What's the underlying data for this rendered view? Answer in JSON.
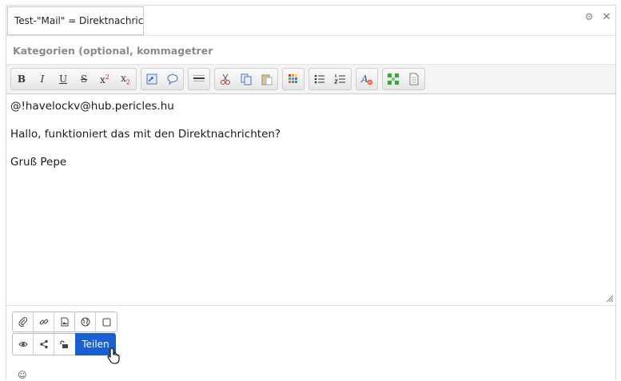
{
  "post": {
    "title_value": "Test-\"Mail\" = Direktnachric",
    "categories_placeholder": "Kategorien (optional, kommagetrer",
    "body": [
      "@!havelockv@hub.pericles.hu",
      "Hallo, funktioniert das mit den Direktnachrichten?",
      "Gruß Pepe"
    ]
  },
  "toolbar": {
    "groups": [
      [
        "bold-icon",
        "italic-icon",
        "underline-icon",
        "strikethrough-icon",
        "superscript-icon",
        "subscript-icon"
      ],
      [
        "insert-link-icon",
        "speech-bubble-icon"
      ],
      [
        "horizontal-rule-icon"
      ],
      [
        "cut-icon",
        "copy-icon",
        "paste-icon"
      ],
      [
        "color-palette-icon"
      ],
      [
        "bulleted-list-icon",
        "numbered-list-icon"
      ],
      [
        "clear-format-icon"
      ],
      [
        "grid-icon",
        "document-icon"
      ]
    ],
    "bold_label": "B",
    "italic_label": "I",
    "underline_label": "U",
    "strike_label": "S",
    "sup_label": "x",
    "sub_label": "x"
  },
  "actions": {
    "share_label": "Teilen"
  },
  "colors": {
    "accent": "#1a5fd0"
  }
}
